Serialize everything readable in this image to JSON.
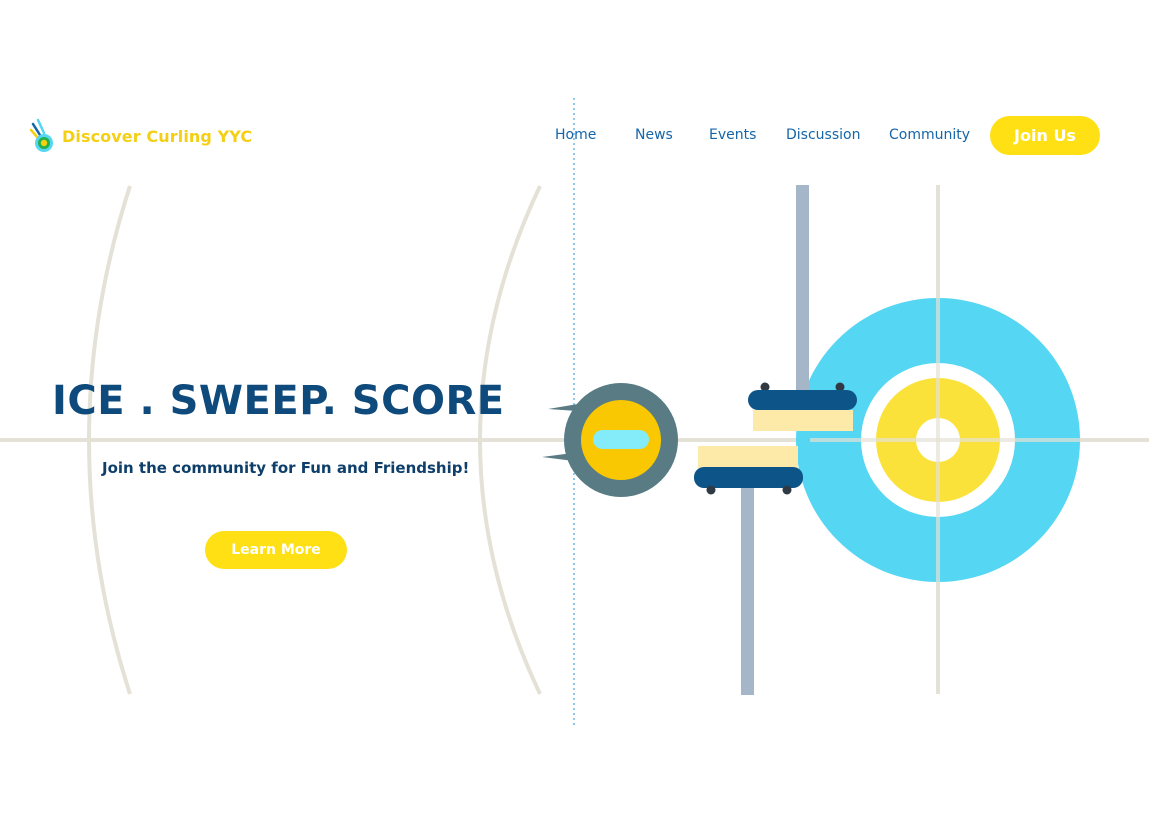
{
  "brand": {
    "name": "Discover Curling YYC",
    "logo_icon": "curling-stone-logo-icon"
  },
  "nav": {
    "items": [
      {
        "label": "Home"
      },
      {
        "label": "News"
      },
      {
        "label": "Events"
      },
      {
        "label": "Discussion"
      },
      {
        "label": "Community"
      }
    ],
    "cta_label": "Join Us"
  },
  "hero": {
    "headline": "ICE . SWEEP. SCORE",
    "tagline": "Join the community for Fun and Friendship!",
    "button_label": "Learn More"
  },
  "colors": {
    "accent_yellow": "#ffe015",
    "navy": "#0e4a7c",
    "link_blue": "#1565a8",
    "house_blue": "#55d6f2",
    "rink_line": "#e4e2d6"
  }
}
